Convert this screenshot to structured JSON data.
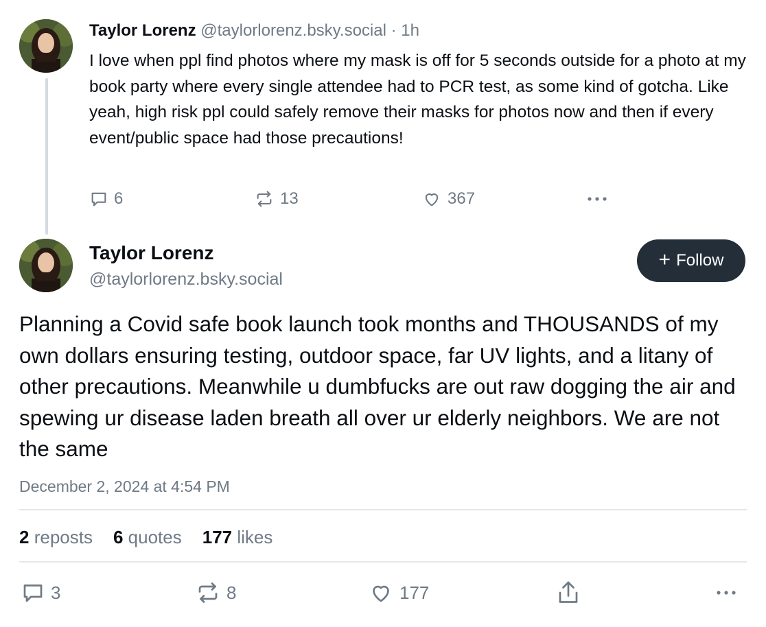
{
  "parent_post": {
    "author_name": "Taylor Lorenz",
    "handle": "@taylorlorenz.bsky.social",
    "separator": "·",
    "time_ago": "1h",
    "text": "I love when ppl find photos where my mask is off for 5 seconds outside for a photo at my book party where every single attendee had to PCR test, as some kind of gotcha. Like yeah, high risk ppl could safely remove their masks for photos now and then if every event/public space had those precautions!",
    "replies": "6",
    "reposts": "13",
    "likes": "367",
    "more_icon": "ellipsis-icon"
  },
  "main_post": {
    "author_name": "Taylor Lorenz",
    "handle": "@taylorlorenz.bsky.social",
    "follow_label": "Follow",
    "follow_icon": "plus-icon",
    "text": "Planning a Covid safe book launch took months and THOUSANDS of my own dollars ensuring testing, outdoor space, far UV lights, and a litany of other precautions. Meanwhile u dumbfucks are out raw dogging the air and spewing ur disease laden breath all over ur elderly neighbors. We are not the same",
    "timestamp": "December 2, 2024 at 4:54 PM",
    "stats": {
      "reposts_count": "2",
      "reposts_label": "reposts",
      "quotes_count": "6",
      "quotes_label": "quotes",
      "likes_count": "177",
      "likes_label": "likes"
    },
    "actions": {
      "replies": "3",
      "reposts": "8",
      "likes": "177"
    }
  },
  "colors": {
    "text": "#0b0f14",
    "muted": "#6f7a86",
    "follow_button_bg": "#232e39",
    "divider": "#e3e7eb",
    "thread_line": "#d5dbe1"
  }
}
